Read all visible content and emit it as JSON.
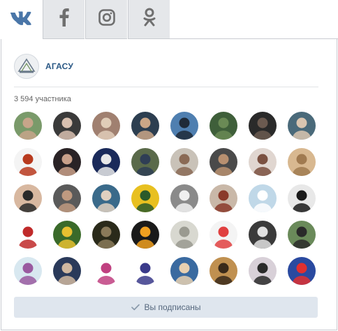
{
  "tabs": [
    {
      "id": "vk",
      "icon": "vk-logo-icon",
      "active": true
    },
    {
      "id": "facebook",
      "icon": "facebook-icon",
      "active": false
    },
    {
      "id": "instagram",
      "icon": "instagram-icon",
      "active": false
    },
    {
      "id": "odnoklassniki",
      "icon": "odnoklassniki-icon",
      "active": false
    }
  ],
  "group": {
    "name": "АГАСУ",
    "members_label": "3 594 участника"
  },
  "subscribe_label": "Вы подписаны",
  "colors": {
    "vk_blue": "#4a76a8",
    "link": "#2a5885",
    "button_bg": "#dfe6ee",
    "button_text": "#55677d"
  },
  "avatars": [
    {
      "bg": "#7a9a6a",
      "fg": "#c7a58a"
    },
    {
      "bg": "#3a3a3a",
      "fg": "#d8c0b0"
    },
    {
      "bg": "#a08070",
      "fg": "#e0cdb8"
    },
    {
      "bg": "#2c3e50",
      "fg": "#caa687"
    },
    {
      "bg": "#4f7fb0",
      "fg": "#1f2a38"
    },
    {
      "bg": "#3f5f3a",
      "fg": "#6a8a55"
    },
    {
      "bg": "#2a2a2a",
      "fg": "#6b5a50"
    },
    {
      "bg": "#4a6a7a",
      "fg": "#d9c5b0"
    },
    {
      "bg": "#f4f4f4",
      "fg": "#b83a1e"
    },
    {
      "bg": "#2a2326",
      "fg": "#c9a08a"
    },
    {
      "bg": "#1a2a5a",
      "fg": "#e8e8e8"
    },
    {
      "bg": "#5a6a4a",
      "fg": "#2f3e55"
    },
    {
      "bg": "#c9c2b8",
      "fg": "#8a6a55"
    },
    {
      "bg": "#4a4a4a",
      "fg": "#b89070"
    },
    {
      "bg": "#e0d6d0",
      "fg": "#7a5040"
    },
    {
      "bg": "#d8b890",
      "fg": "#a07a50"
    },
    {
      "bg": "#d8b8a0",
      "fg": "#2a2a2a"
    },
    {
      "bg": "#5a5a5a",
      "fg": "#c09a80"
    },
    {
      "bg": "#3a6a8a",
      "fg": "#e0d0c0"
    },
    {
      "bg": "#e8c020",
      "fg": "#2a5a2a"
    },
    {
      "bg": "#8a8a8a",
      "fg": "#f0f0f0"
    },
    {
      "bg": "#c9b8a8",
      "fg": "#8a3a2a"
    },
    {
      "bg": "#c0d8e8",
      "fg": "#ffffff"
    },
    {
      "bg": "#e8e8e8",
      "fg": "#1a1a1a"
    },
    {
      "bg": "#ffffff",
      "fg": "#c02a2a"
    },
    {
      "bg": "#3a6a2a",
      "fg": "#e8c030"
    },
    {
      "bg": "#2a2a1a",
      "fg": "#8a7a5a"
    },
    {
      "bg": "#1a1a1a",
      "fg": "#f0a020"
    },
    {
      "bg": "#d8d8d0",
      "fg": "#9a9a90"
    },
    {
      "bg": "#f4f4f4",
      "fg": "#e04040"
    },
    {
      "bg": "#3a3a3a",
      "fg": "#e0e0e0"
    },
    {
      "bg": "#6a8a5a",
      "fg": "#2a2a2a"
    },
    {
      "bg": "#d8e8f0",
      "fg": "#9a5aa0"
    },
    {
      "bg": "#2a3a5a",
      "fg": "#d0b8a0"
    },
    {
      "bg": "#ffffff",
      "fg": "#c04080"
    },
    {
      "bg": "#ffffff",
      "fg": "#3a3a8a"
    },
    {
      "bg": "#3a6aa0",
      "fg": "#e8d0b0"
    },
    {
      "bg": "#c09050",
      "fg": "#3a2a1a"
    },
    {
      "bg": "#d8d0d8",
      "fg": "#2a2a2a"
    },
    {
      "bg": "#2a4aa0",
      "fg": "#e03030"
    }
  ]
}
